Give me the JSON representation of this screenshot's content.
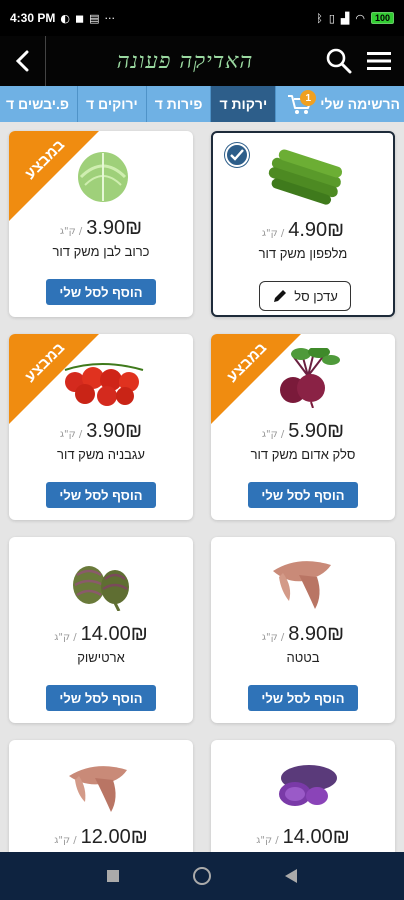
{
  "status_bar": {
    "time": "4:30 PM",
    "battery": "100"
  },
  "app_bar": {
    "logo_text": "האדיקה פעונה"
  },
  "tabs": {
    "cart_badge": "1",
    "items": [
      {
        "label": "הרשימה שלי"
      },
      {
        "label": "ירקות ד"
      },
      {
        "label": "פירות ד"
      },
      {
        "label": "ירוקים ד"
      },
      {
        "label": "פ.יבשים ד"
      }
    ]
  },
  "products": [
    {
      "name": "מלפפון משק דור",
      "price": "4.90₪",
      "unit": "/ ק\"ג",
      "icon": "cucumber",
      "sale": false,
      "selected": true,
      "action": "עדכן סל"
    },
    {
      "name": "כרוב לבן משק דור",
      "price": "3.90₪",
      "unit": "/ ק\"ג",
      "icon": "cabbage",
      "sale": true,
      "selected": false,
      "action": "הוסף לסל שלי"
    },
    {
      "name": "סלק אדום משק דור",
      "price": "5.90₪",
      "unit": "/ ק\"ג",
      "icon": "beet",
      "sale": true,
      "selected": false,
      "action": "הוסף לסל שלי"
    },
    {
      "name": "עגבניה משק דור",
      "price": "3.90₪",
      "unit": "/ ק\"ג",
      "icon": "tomato",
      "sale": true,
      "selected": false,
      "action": "הוסף לסל שלי"
    },
    {
      "name": "בטטה",
      "price": "8.90₪",
      "unit": "/ ק\"ג",
      "icon": "sweet-potato",
      "sale": false,
      "selected": false,
      "action": "הוסף לסל שלי"
    },
    {
      "name": "ארטישוק",
      "price": "14.00₪",
      "unit": "/ ק\"ג",
      "icon": "artichoke",
      "sale": false,
      "selected": false,
      "action": "הוסף לסל שלי"
    },
    {
      "name": "",
      "price": "14.00₪",
      "unit": "/ ק\"ג",
      "icon": "purple-potato",
      "sale": false,
      "selected": false,
      "action": ""
    },
    {
      "name": "",
      "price": "12.00₪",
      "unit": "/ ק\"ג",
      "icon": "sweet-potato",
      "sale": false,
      "selected": false,
      "action": ""
    }
  ],
  "sale_label": "במבצע",
  "colors": {
    "tab_bar": "#6fb1e4",
    "tab_active": "#2d5e8a",
    "button": "#2f73b8",
    "sale_ribbon": "#f08c10",
    "nav_bar": "#0e2340"
  }
}
